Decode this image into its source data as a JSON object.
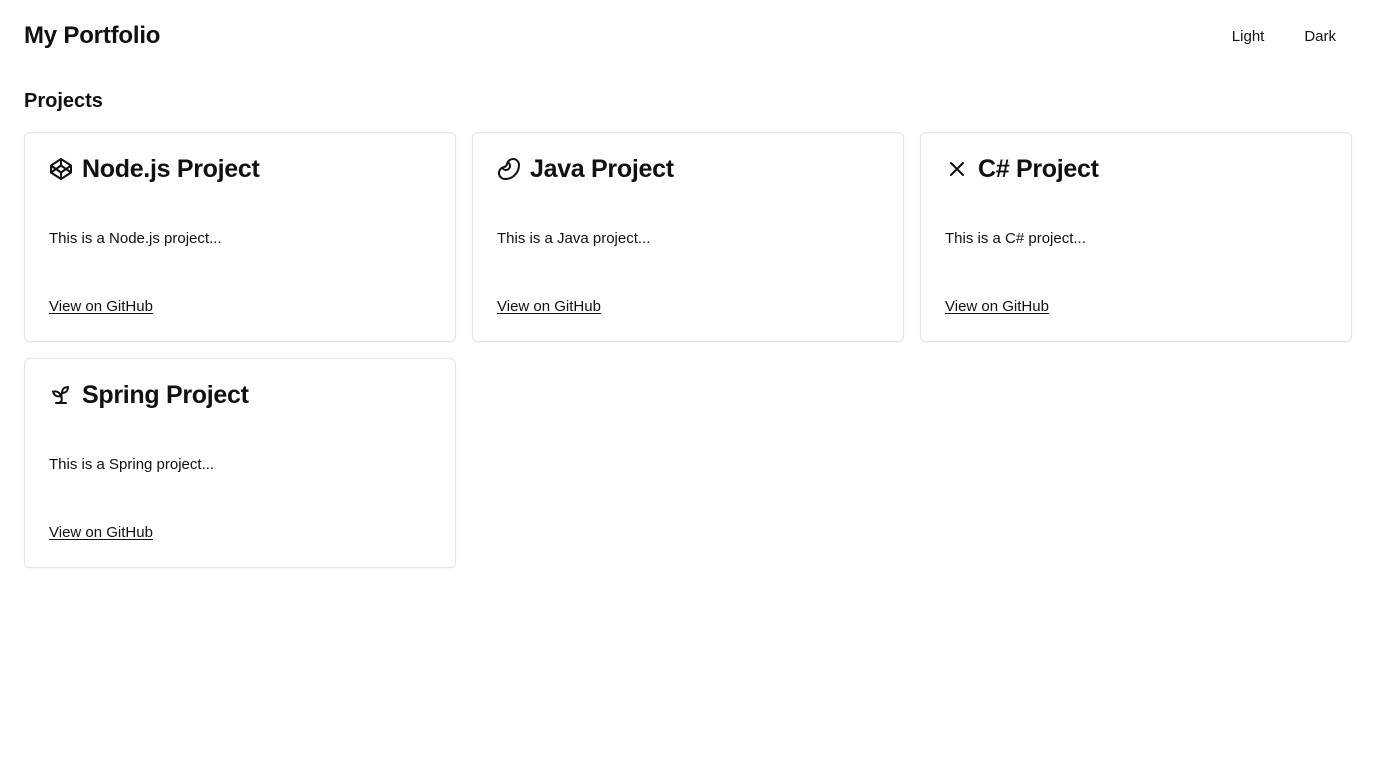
{
  "header": {
    "title": "My Portfolio",
    "theme_buttons": [
      "Light",
      "Dark"
    ]
  },
  "projects_section": {
    "title": "Projects",
    "cards": [
      {
        "icon": "codepen-icon",
        "title": "Node.js Project",
        "description": "This is a Node.js project...",
        "link": "View on GitHub"
      },
      {
        "icon": "bean-icon",
        "title": "Java Project",
        "description": "This is a Java project...",
        "link": "View on GitHub"
      },
      {
        "icon": "x-icon",
        "title": "C# Project",
        "description": "This is a C# project...",
        "link": "View on GitHub"
      },
      {
        "icon": "sprout-icon",
        "title": "Spring Project",
        "description": "This is a Spring project...",
        "link": "View on GitHub"
      }
    ]
  }
}
